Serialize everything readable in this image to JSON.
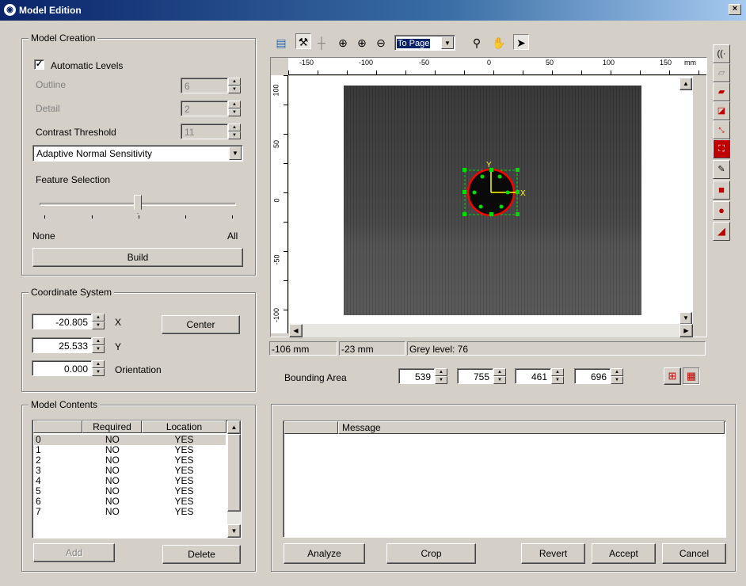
{
  "window": {
    "title": "Model Edition",
    "close_glyph": "×"
  },
  "model_creation": {
    "title": "Model Creation",
    "automatic_levels_label": "Automatic Levels",
    "automatic_levels_checked": true,
    "outline_label": "Outline",
    "outline_value": "6",
    "detail_label": "Detail",
    "detail_value": "2",
    "contrast_label": "Contrast Threshold",
    "contrast_value": "11",
    "sensitivity_selected": "Adaptive Normal Sensitivity",
    "feature_selection_label": "Feature Selection",
    "feature_selection_level": 0.5,
    "slider_min_label": "None",
    "slider_max_label": "All",
    "build_label": "Build"
  },
  "coordinate_system": {
    "title": "Coordinate System",
    "x_value": "-20.805",
    "x_label": "X",
    "y_value": "25.533",
    "y_label": "Y",
    "orientation_value": "0.000",
    "orientation_label": "Orientation",
    "center_label": "Center"
  },
  "model_contents": {
    "title": "Model Contents",
    "columns": [
      "",
      "Required",
      "Location"
    ],
    "rows": [
      [
        "0",
        "NO",
        "YES"
      ],
      [
        "1",
        "NO",
        "YES"
      ],
      [
        "2",
        "NO",
        "YES"
      ],
      [
        "3",
        "NO",
        "YES"
      ],
      [
        "4",
        "NO",
        "YES"
      ],
      [
        "5",
        "NO",
        "YES"
      ],
      [
        "6",
        "NO",
        "YES"
      ],
      [
        "7",
        "NO",
        "YES"
      ]
    ],
    "add_label": "Add",
    "delete_label": "Delete"
  },
  "toolbar": {
    "zoom_selected": "To Page"
  },
  "ruler": {
    "top_ticks": [
      "-150",
      "-100",
      "-50",
      "0",
      "50",
      "100",
      "150"
    ],
    "unit": "mm",
    "left_ticks": [
      "100",
      "50",
      "0",
      "-50",
      "-100"
    ]
  },
  "viewer": {
    "axis_x_label": "X",
    "axis_y_label": "Y",
    "status_x": "-106 mm",
    "status_y": "-23 mm",
    "status_grey": "Grey level: 76"
  },
  "bounding_area": {
    "label": "Bounding Area",
    "values": [
      "539",
      "755",
      "461",
      "696"
    ]
  },
  "messages": {
    "column_header": "Message"
  },
  "actions": {
    "analyze_label": "Analyze",
    "crop_label": "Crop",
    "revert_label": "Revert",
    "accept_label": "Accept",
    "cancel_label": "Cancel"
  },
  "colors": {
    "title_start": "#0a246a",
    "title_end": "#a6caf0",
    "model_outline": "#ff0000",
    "model_points": "#00dd00",
    "axes": "#ffff00"
  }
}
